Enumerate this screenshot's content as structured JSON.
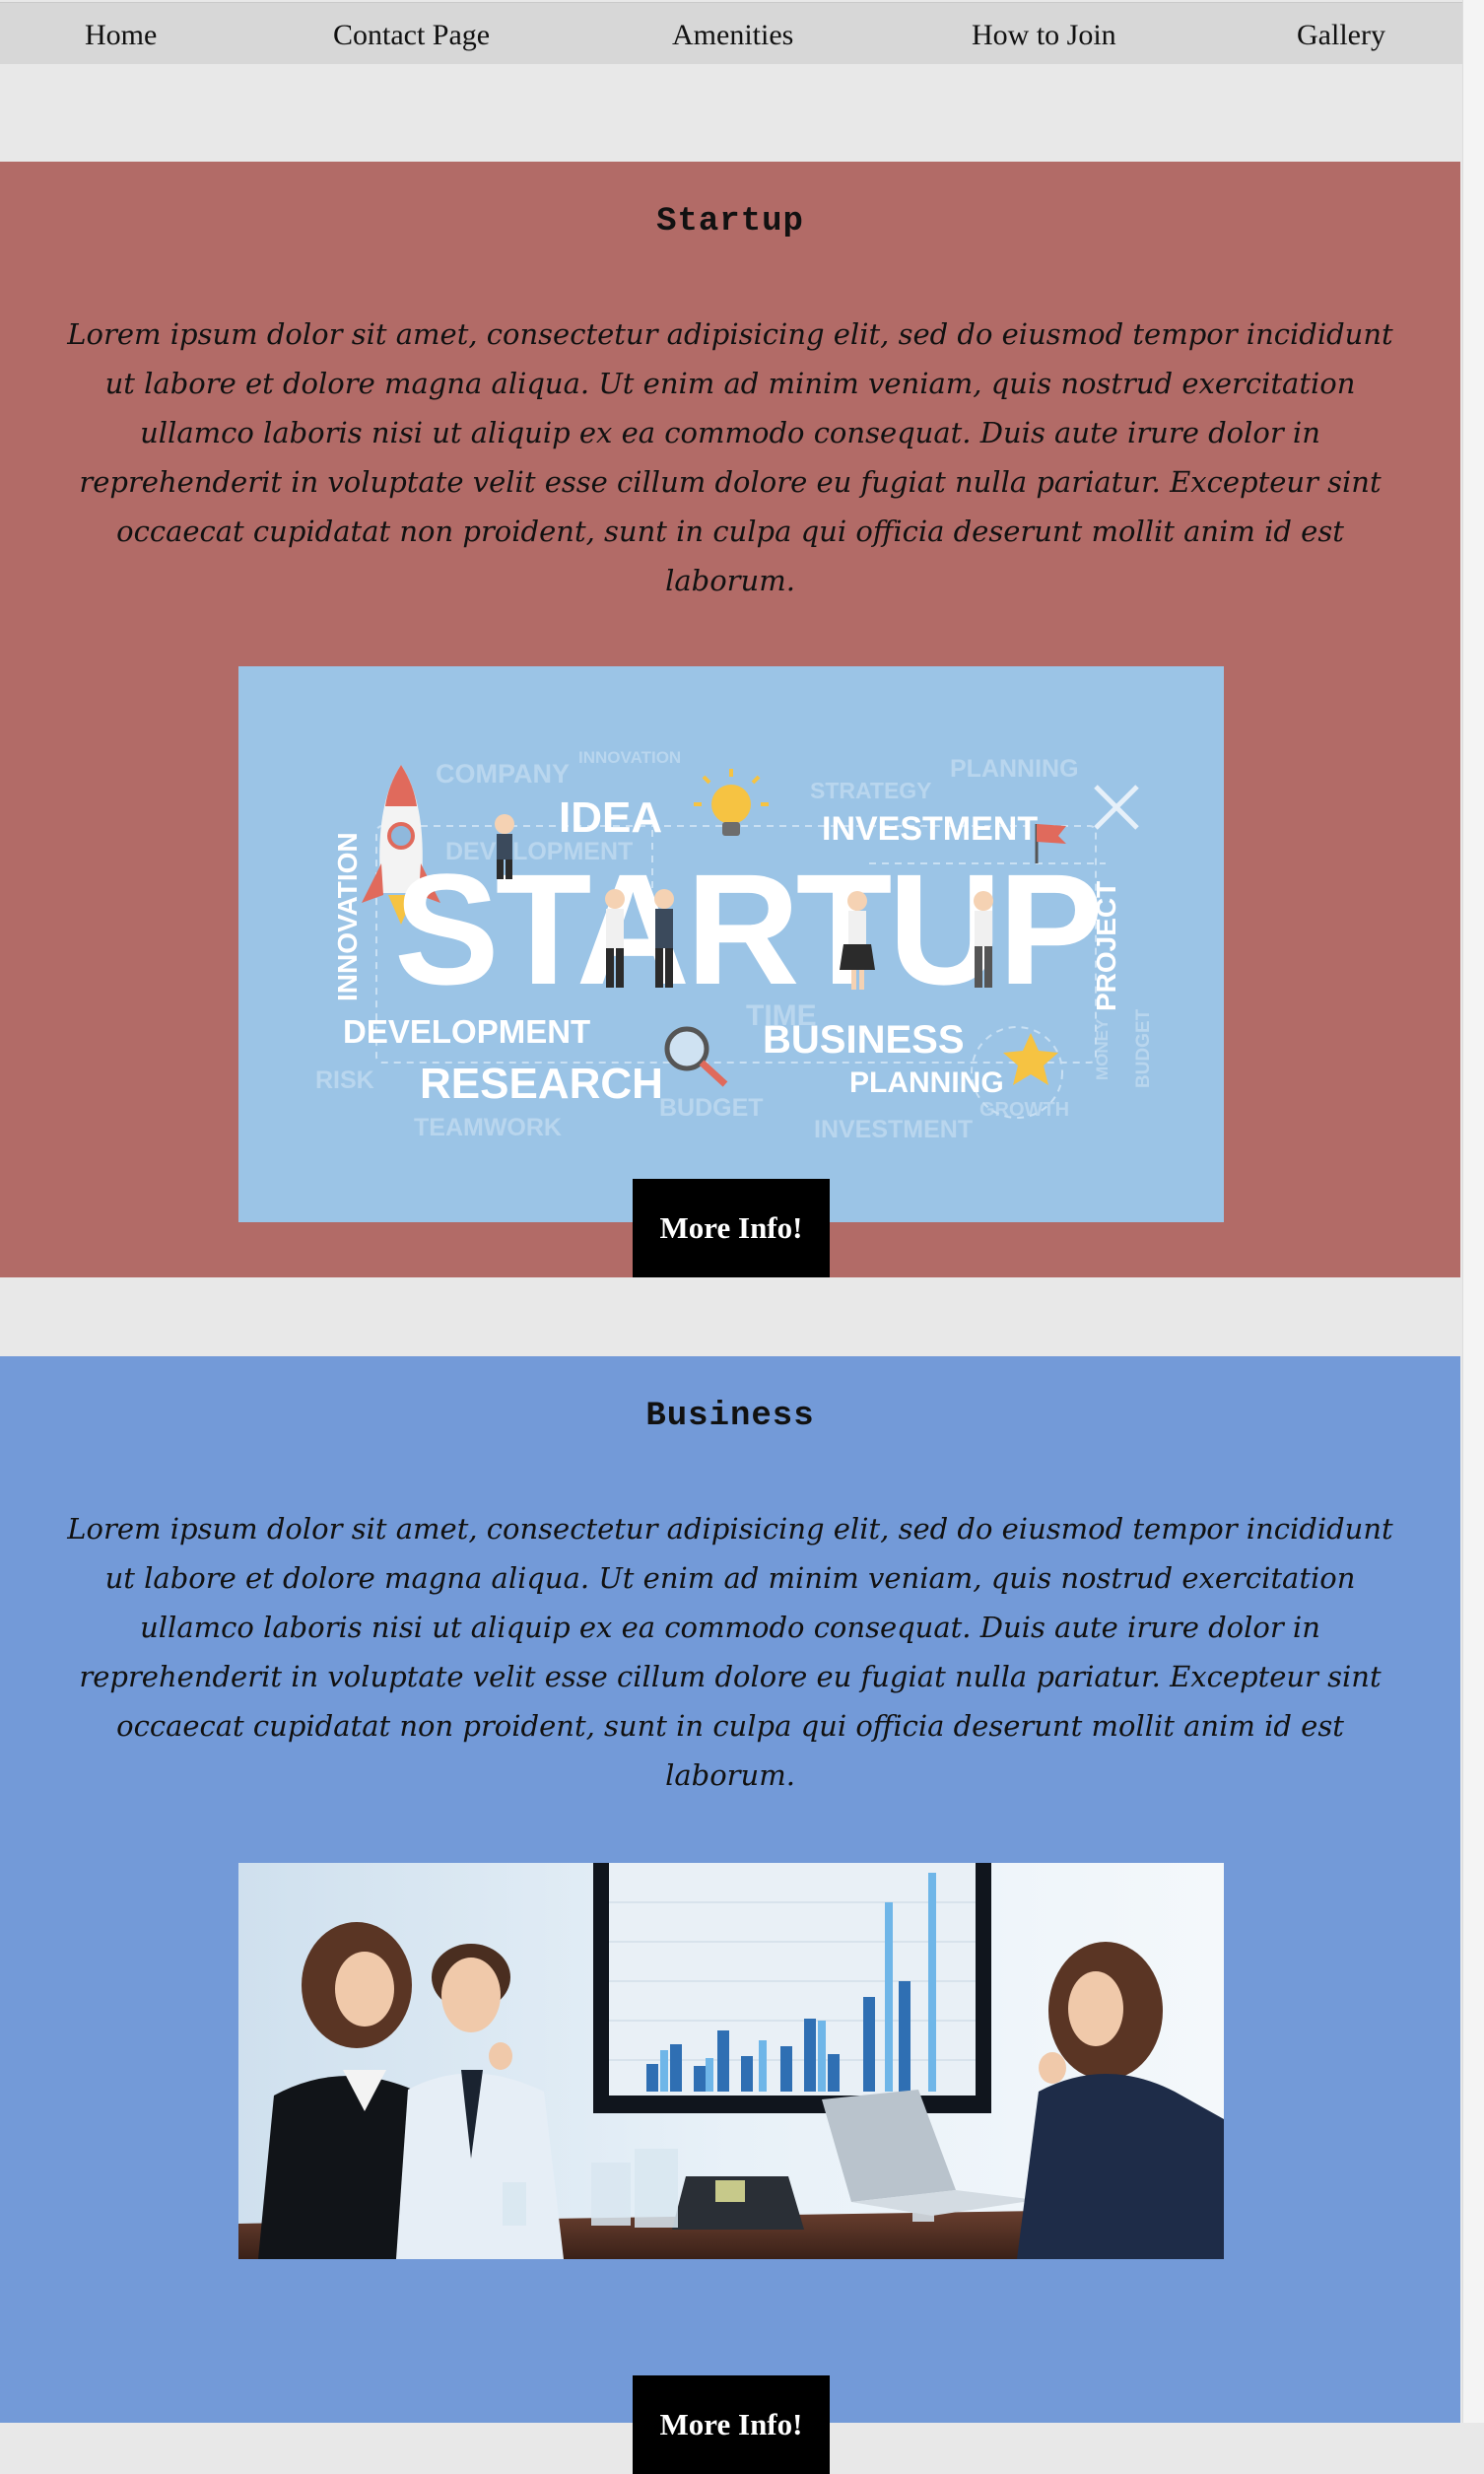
{
  "nav": {
    "items": [
      {
        "label": "Home"
      },
      {
        "label": "Contact Page"
      },
      {
        "label": "Amenities"
      },
      {
        "label": "How to Join"
      },
      {
        "label": "Gallery"
      }
    ]
  },
  "sections": [
    {
      "title": "Startup",
      "body": "Lorem ipsum dolor sit amet, consectetur adipisicing elit, sed do eiusmod tempor incididunt ut labore et dolore magna aliqua. Ut enim ad minim veniam, quis nostrud exercitation ullamco laboris nisi ut aliquip ex ea commodo consequat. Duis aute irure dolor in reprehenderit in voluptate velit esse cillum dolore eu fugiat nulla pariatur. Excepteur sint occaecat cupidatat non proident, sunt in culpa qui officia deserunt mollit anim id est laborum.",
      "button_label": "More Info!",
      "bg_color": "#b26b67",
      "image": {
        "words": {
          "main": "STARTUP",
          "idea": "IDEA",
          "investment": "INVESTMENT",
          "planning_top": "PLANNING",
          "company": "COMPANY",
          "innovation_small": "INNOVATION",
          "strategy": "STRATEGY",
          "development_small": "DEVELOPMENT",
          "innovation_vertical": "INNOVATION",
          "project": "PROJECT",
          "development": "DEVELOPMENT",
          "business": "BUSINESS",
          "research": "RESEARCH",
          "planning": "PLANNING",
          "risk": "RISK",
          "budget": "BUDGET",
          "growth": "GROWTH",
          "teamwork": "TEAMWORK",
          "investment_small": "INVESTMENT",
          "time": "TIME",
          "money": "MONEY",
          "budget_vertical": "BUDGET"
        }
      }
    },
    {
      "title": "Business",
      "body": "Lorem ipsum dolor sit amet, consectetur adipisicing elit, sed do eiusmod tempor incididunt ut labore et dolore magna aliqua. Ut enim ad minim veniam, quis nostrud exercitation ullamco laboris nisi ut aliquip ex ea commodo consequat. Duis aute irure dolor in reprehenderit in voluptate velit esse cillum dolore eu fugiat nulla pariatur. Excepteur sint occaecat cupidatat non proident, sunt in culpa qui officia deserunt mollit anim id est laborum.",
      "button_label": "More Info!",
      "bg_color": "#739ad8"
    }
  ]
}
